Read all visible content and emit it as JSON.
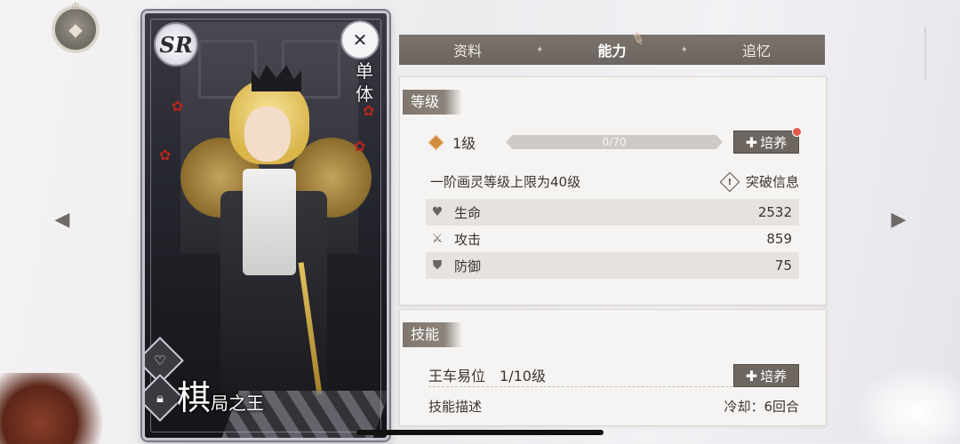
{
  "tabs": [
    {
      "label": "资料"
    },
    {
      "label": "能力"
    },
    {
      "label": "追忆"
    }
  ],
  "card": {
    "rarity": "SR",
    "target": "单体",
    "name_big": "棋",
    "name_small": "局之王"
  },
  "level_section": {
    "title": "等级",
    "level": "1级",
    "exp_text": "0/70",
    "exp_progress": 0,
    "train_label": "培养",
    "cap_text": "一阶画灵等级上限为40级",
    "breakthrough_label": "突破信息",
    "stats": [
      {
        "name": "生命",
        "value": "2532",
        "icon": "heart-icon"
      },
      {
        "name": "攻击",
        "value": "859",
        "icon": "swords-icon"
      },
      {
        "name": "防御",
        "value": "75",
        "icon": "shield-icon"
      }
    ]
  },
  "skill_section": {
    "title": "技能",
    "skill_name": "王车易位",
    "skill_level": "1/10级",
    "train_label": "培养",
    "desc_label": "技能描述",
    "cooldown": "冷却：6回合"
  }
}
